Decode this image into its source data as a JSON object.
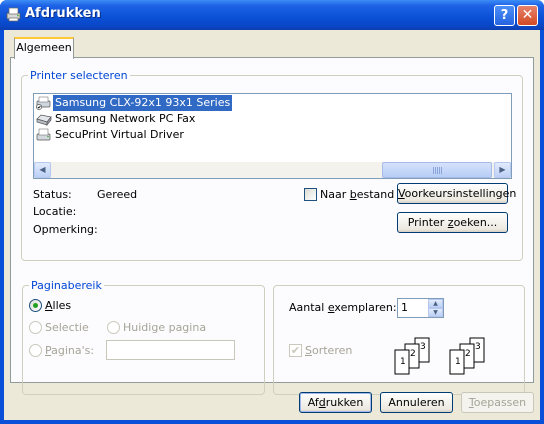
{
  "window": {
    "title": "Afdrukken",
    "help_glyph": "?",
    "close_glyph": "✕"
  },
  "tabs": [
    {
      "label": "Algemeen",
      "selected": true
    }
  ],
  "printer_group": {
    "legend": "Printer selecteren",
    "printers": [
      {
        "name": "Samsung CLX-92x1 93x1 Series",
        "selected": true,
        "icon": "printer-default-icon"
      },
      {
        "name": "Samsung Network PC Fax",
        "selected": false,
        "icon": "fax-icon"
      },
      {
        "name": "SecuPrint Virtual Driver",
        "selected": false,
        "icon": "printer-icon"
      }
    ],
    "status_label": "Status:",
    "status_value": "Gereed",
    "location_label": "Locatie:",
    "location_value": "",
    "comment_label": "Opmerking:",
    "comment_value": "",
    "print_to_file": {
      "label_pre": "Naar ",
      "label_ul": "b",
      "label_post": "estand",
      "checked": false
    },
    "preferences_button": {
      "ul": "V",
      "rest": "oorkeursinstellingen"
    },
    "find_printer_button": {
      "pre": "Printer ",
      "ul": "z",
      "post": "oeken..."
    }
  },
  "page_range_group": {
    "legend": "Paginabereik",
    "all": {
      "ul": "A",
      "rest": "lles",
      "selected": true
    },
    "selection": {
      "label": "Selectie",
      "enabled": false
    },
    "current_page": {
      "label": "Huidige pagina",
      "enabled": false
    },
    "pages": {
      "ul": "P",
      "rest": "agina's:",
      "enabled": false,
      "value": ""
    }
  },
  "copies_group": {
    "copies_label_pre": "Aantal ",
    "copies_label_ul": "e",
    "copies_label_post": "xemplaren:",
    "copies_value": "1",
    "collate": {
      "ul": "S",
      "rest": "orteren",
      "checked": true,
      "enabled": false
    },
    "collate_pages": [
      "1",
      "2",
      "3"
    ]
  },
  "buttons": {
    "print": {
      "pre": "Af",
      "ul": "d",
      "post": "rukken"
    },
    "cancel": "Annuleren",
    "apply": {
      "ul": "T",
      "rest": "oepassen",
      "enabled": false
    }
  },
  "colors": {
    "title_bar": "#0b52d8",
    "dialog_face": "#ece9d8",
    "tab_accent": "#ffc83c",
    "group_legend": "#0046d5",
    "selection": "#316ac5"
  }
}
